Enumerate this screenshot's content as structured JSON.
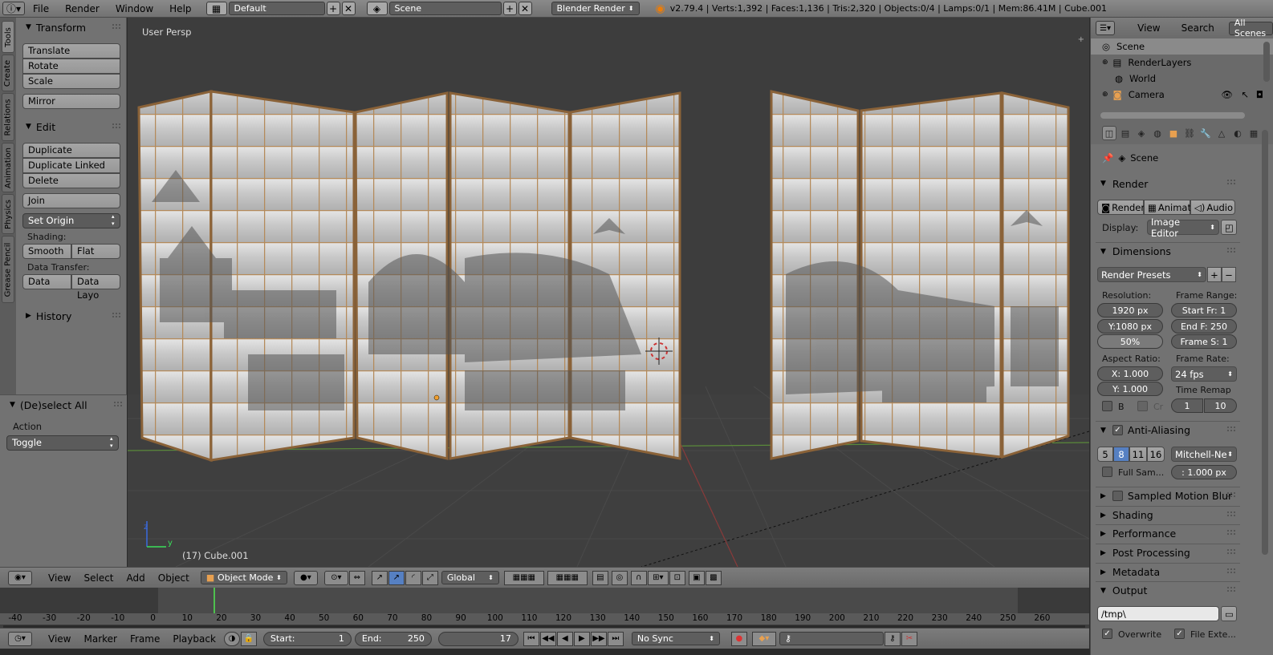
{
  "topbar": {
    "menus": [
      "File",
      "Render",
      "Window",
      "Help"
    ],
    "screen_layout": "Default",
    "scene": "Scene",
    "engine": "Blender Render",
    "stats": "v2.79.4 | Verts:1,392 | Faces:1,136 | Tris:2,320 | Objects:0/4 | Lamps:0/1 | Mem:86.41M | Cube.001"
  },
  "toolshelf": {
    "tabs": [
      "Tools",
      "Create",
      "Relations",
      "Animation",
      "Physics",
      "Grease Pencil"
    ],
    "transform": {
      "title": "Transform",
      "buttons": [
        "Translate",
        "Rotate",
        "Scale"
      ],
      "mirror": "Mirror"
    },
    "edit": {
      "title": "Edit",
      "buttons": [
        "Duplicate",
        "Duplicate Linked",
        "Delete"
      ],
      "join": "Join",
      "set_origin": "Set Origin"
    },
    "shading": {
      "label": "Shading:",
      "smooth": "Smooth",
      "flat": "Flat"
    },
    "data_transfer": {
      "label": "Data Transfer:",
      "data": "Data",
      "data_layout": "Data Layo"
    },
    "history": "History"
  },
  "operator": {
    "title": "(De)select All",
    "action_label": "Action",
    "action_value": "Toggle"
  },
  "viewport": {
    "view_label": "User Persp",
    "object_label": "(17) Cube.001"
  },
  "viewport_header": {
    "menus": [
      "View",
      "Select",
      "Add",
      "Object"
    ],
    "mode": "Object Mode",
    "orientation": "Global"
  },
  "timeline": {
    "ticks": [
      "-40",
      "-30",
      "-20",
      "-10",
      "0",
      "10",
      "20",
      "30",
      "40",
      "50",
      "60",
      "70",
      "80",
      "90",
      "100",
      "110",
      "120",
      "130",
      "140",
      "150",
      "160",
      "170",
      "180",
      "190",
      "200",
      "210",
      "220",
      "230",
      "240",
      "250",
      "260"
    ],
    "current_frame": 17
  },
  "bottombar": {
    "menus": [
      "View",
      "Marker",
      "Frame",
      "Playback"
    ],
    "start_label": "Start:",
    "start": "1",
    "end_label": "End:",
    "end": "250",
    "frame": "17",
    "sync": "No Sync"
  },
  "outliner": {
    "menus": [
      "View",
      "Search"
    ],
    "filter": "All Scenes",
    "rows": [
      "Scene",
      "RenderLayers",
      "World",
      "Camera"
    ]
  },
  "properties": {
    "context": "Scene",
    "render": {
      "title": "Render",
      "render_btn": "Render",
      "anim_btn": "Animati",
      "audio_btn": "Audio",
      "display_label": "Display:",
      "display": "Image Editor"
    },
    "dimensions": {
      "title": "Dimensions",
      "presets": "Render Presets",
      "resolution_label": "Resolution:",
      "res_x": "1920 px",
      "res_y": "Y:1080 px",
      "res_pct": "50%",
      "frame_range_label": "Frame Range:",
      "start": "Start Fr:  1",
      "end": "End F: 250",
      "step": "Frame S: 1",
      "aspect_label": "Aspect Ratio:",
      "asp_x": "X:   1.000",
      "asp_y": "Y:   1.000",
      "frame_rate_label": "Frame Rate:",
      "fps": "24 fps",
      "time_remap_label": "Time Remap",
      "remap_old": "1",
      "remap_new": "10",
      "border": "B",
      "crop": "Cr"
    },
    "aa": {
      "title": "Anti-Aliasing",
      "samples": [
        "5",
        "8",
        "11",
        "16"
      ],
      "filter": "Mitchell-Ne",
      "full_sample": "Full Sam...",
      "size": ": 1.000 px"
    },
    "sections": [
      "Sampled Motion Blur",
      "Shading",
      "Performance",
      "Post Processing",
      "Metadata",
      "Output"
    ],
    "output": {
      "path": "/tmp\\",
      "overwrite": "Overwrite",
      "file_ext": "File Exte..."
    }
  }
}
